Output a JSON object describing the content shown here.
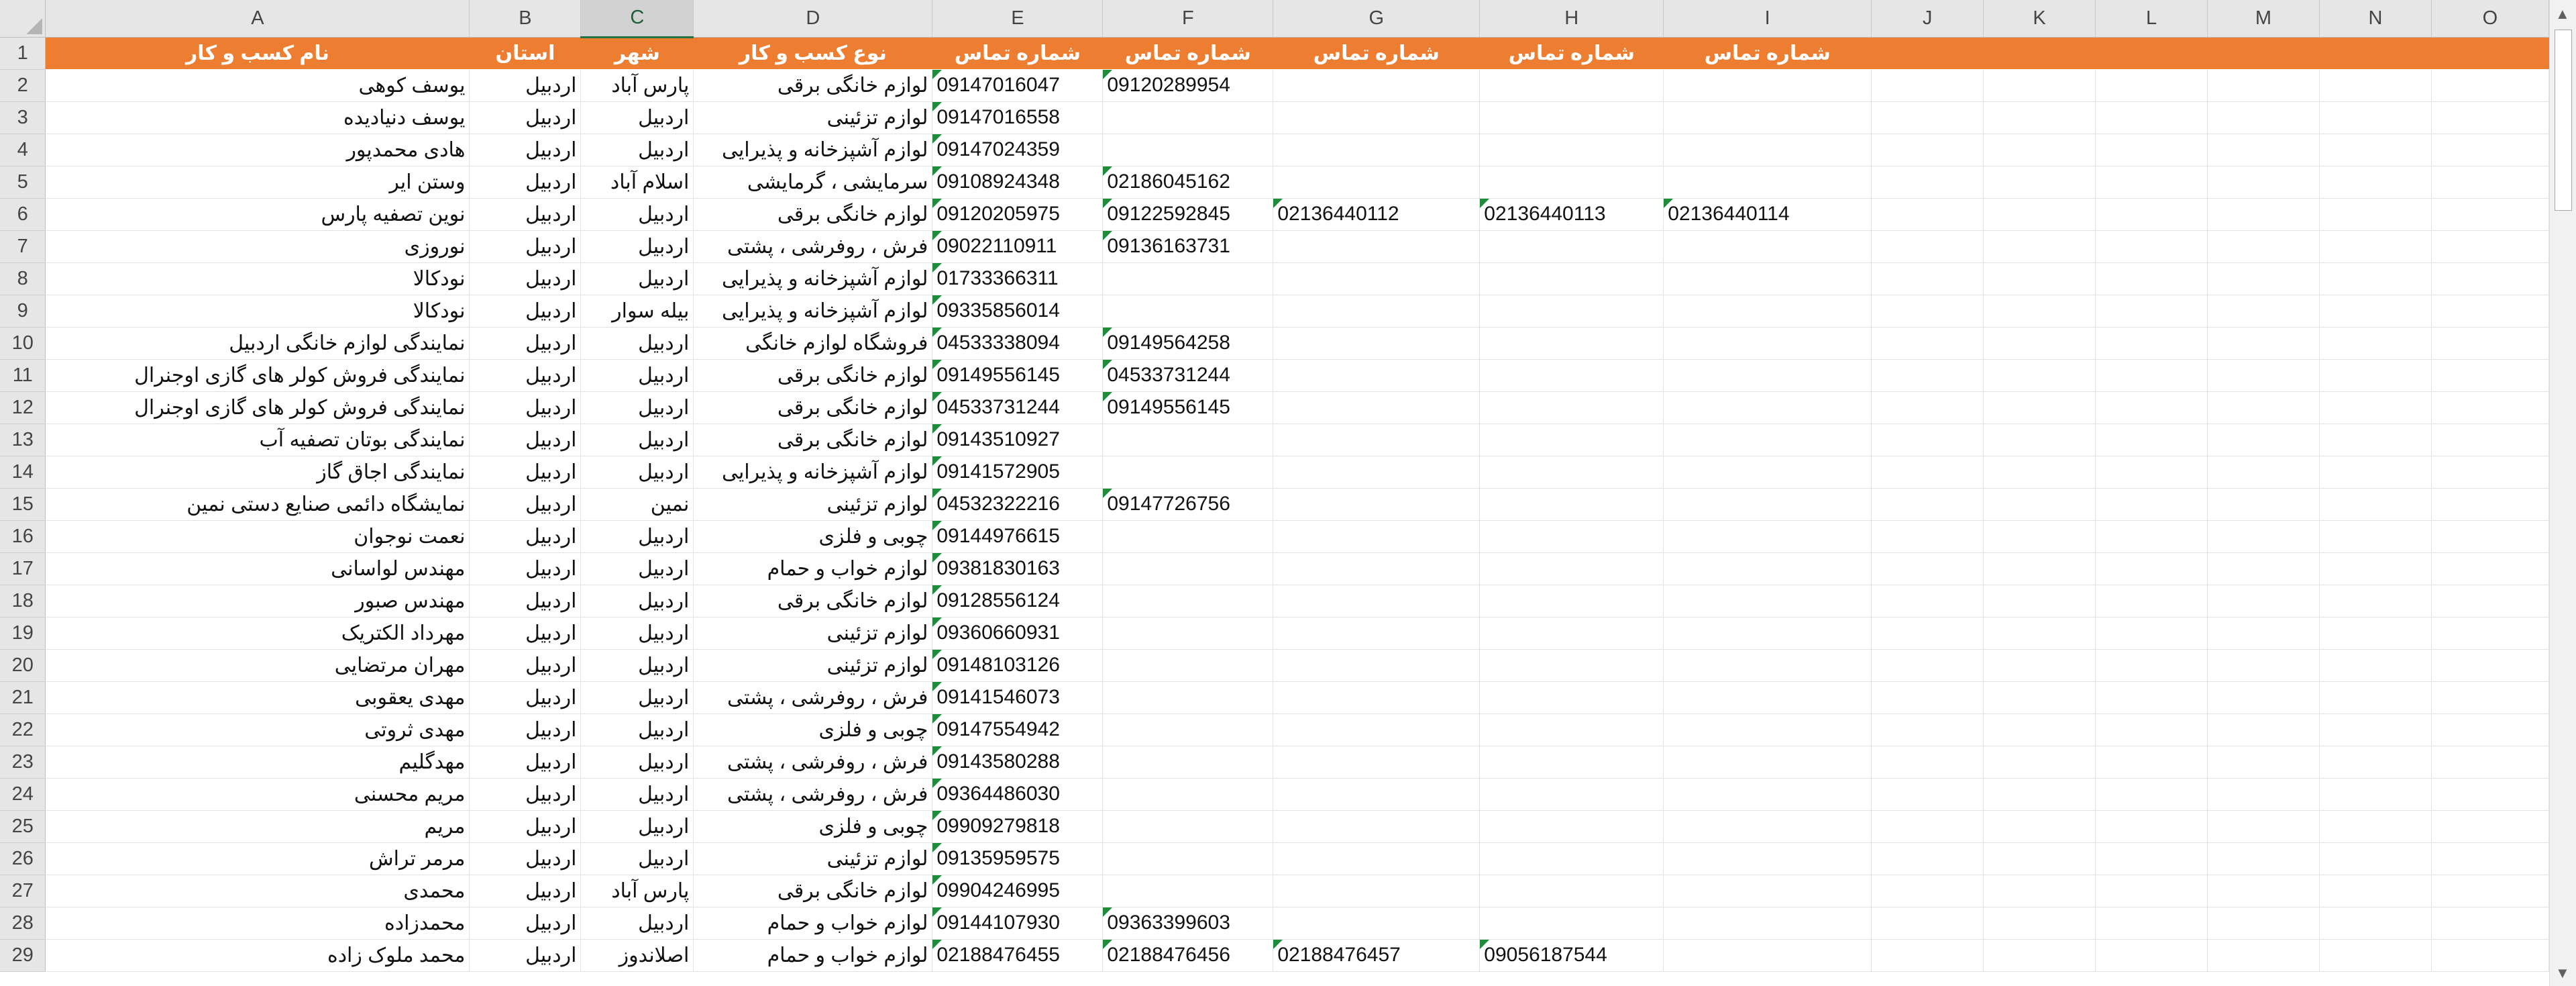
{
  "columns": [
    "A",
    "B",
    "C",
    "D",
    "E",
    "F",
    "G",
    "H",
    "I",
    "J",
    "K",
    "L",
    "M",
    "N",
    "O"
  ],
  "selected_column": "C",
  "colors": {
    "header_fill": "#ed7d31",
    "header_text": "#ffffff",
    "error_flag": "#1e8c3a",
    "selected_header": "#217346"
  },
  "rows": [
    {
      "n": "1",
      "header": true,
      "a": "نام کسب و کار",
      "b": "استان",
      "c": "شهر",
      "d": "نوع کسب و کار",
      "e": "شماره تماس",
      "f": "شماره تماس",
      "g": "شماره تماس",
      "h": "شماره تماس",
      "i": "شماره تماس"
    },
    {
      "n": "2",
      "a": "یوسف کوهی",
      "b": "اردبیل",
      "c": "پارس آباد",
      "d": "لوازم خانگی برقی",
      "e": "09147016047",
      "f": "09120289954",
      "g": "",
      "h": "",
      "i": ""
    },
    {
      "n": "3",
      "a": "یوسف دنیادیده",
      "b": "اردبیل",
      "c": "اردبیل",
      "d": "لوازم تزئینی",
      "e": "09147016558",
      "f": "",
      "g": "",
      "h": "",
      "i": ""
    },
    {
      "n": "4",
      "a": "هادی محمدپور",
      "b": "اردبیل",
      "c": "اردبیل",
      "d": "لوازم آشپزخانه و پذیرایی",
      "e": "09147024359",
      "f": "",
      "g": "",
      "h": "",
      "i": ""
    },
    {
      "n": "5",
      "a": "وستن ایر",
      "b": "اردبیل",
      "c": "اسلام آباد",
      "d": "سرمایشی ، گرمایشی",
      "e": "09108924348",
      "f": "02186045162",
      "g": "",
      "h": "",
      "i": ""
    },
    {
      "n": "6",
      "a": "نوین تصفیه پارس",
      "b": "اردبیل",
      "c": "اردبیل",
      "d": "لوازم خانگی برقی",
      "e": "09120205975",
      "f": "09122592845",
      "g": "02136440112",
      "h": "02136440113",
      "i": "02136440114"
    },
    {
      "n": "7",
      "a": "نوروزی",
      "b": "اردبیل",
      "c": "اردبیل",
      "d": "فرش ، روفرشی ، پشتی",
      "e": "09022110911",
      "f": "09136163731",
      "g": "",
      "h": "",
      "i": ""
    },
    {
      "n": "8",
      "a": "نودکالا",
      "b": "اردبیل",
      "c": "اردبیل",
      "d": "لوازم آشپزخانه و پذیرایی",
      "e": "01733366311",
      "f": "",
      "g": "",
      "h": "",
      "i": ""
    },
    {
      "n": "9",
      "a": "نودکالا",
      "b": "اردبیل",
      "c": "بیله سوار",
      "d": "لوازم آشپزخانه و پذیرایی",
      "e": "09335856014",
      "f": "",
      "g": "",
      "h": "",
      "i": ""
    },
    {
      "n": "10",
      "a": "نمایندگی لوازم خانگی اردبیل",
      "b": "اردبیل",
      "c": "اردبیل",
      "d": "فروشگاه لوازم خانگی",
      "e": "04533338094",
      "f": "09149564258",
      "g": "",
      "h": "",
      "i": ""
    },
    {
      "n": "11",
      "a": "نمایندگی فروش کولر های گازی اوجنرال",
      "b": "اردبیل",
      "c": "اردبیل",
      "d": "لوازم خانگی برقی",
      "e": "09149556145",
      "f": "04533731244",
      "g": "",
      "h": "",
      "i": ""
    },
    {
      "n": "12",
      "a": "نمایندگی فروش کولر های گازی اوجنرال",
      "b": "اردبیل",
      "c": "اردبیل",
      "d": "لوازم خانگی برقی",
      "e": "04533731244",
      "f": "09149556145",
      "g": "",
      "h": "",
      "i": ""
    },
    {
      "n": "13",
      "a": "نمایندگی بوتان  تصفیه آب",
      "b": "اردبیل",
      "c": "اردبیل",
      "d": "لوازم خانگی برقی",
      "e": "09143510927",
      "f": "",
      "g": "",
      "h": "",
      "i": ""
    },
    {
      "n": "14",
      "a": "نمایندگی اجاق گاز",
      "b": "اردبیل",
      "c": "اردبیل",
      "d": "لوازم آشپزخانه و پذیرایی",
      "e": "09141572905",
      "f": "",
      "g": "",
      "h": "",
      "i": ""
    },
    {
      "n": "15",
      "a": "نمایشگاه دائمی صنایع دستی نمین",
      "b": "اردبیل",
      "c": "نمین",
      "d": "لوازم تزئینی",
      "e": "04532322216",
      "f": "09147726756",
      "g": "",
      "h": "",
      "i": ""
    },
    {
      "n": "16",
      "a": "نعمت نوجوان",
      "b": "اردبیل",
      "c": "اردبیل",
      "d": "چوبی و فلزی",
      "e": "09144976615",
      "f": "",
      "g": "",
      "h": "",
      "i": ""
    },
    {
      "n": "17",
      "a": "مهندس لواسانی",
      "b": "اردبیل",
      "c": "اردبیل",
      "d": "لوازم خواب و حمام",
      "e": "09381830163",
      "f": "",
      "g": "",
      "h": "",
      "i": ""
    },
    {
      "n": "18",
      "a": "مهندس صبور",
      "b": "اردبیل",
      "c": "اردبیل",
      "d": "لوازم خانگی برقی",
      "e": "09128556124",
      "f": "",
      "g": "",
      "h": "",
      "i": ""
    },
    {
      "n": "19",
      "a": "مهرداد الکتریک",
      "b": "اردبیل",
      "c": "اردبیل",
      "d": "لوازم تزئینی",
      "e": "09360660931",
      "f": "",
      "g": "",
      "h": "",
      "i": ""
    },
    {
      "n": "20",
      "a": "مهران مرتضایی",
      "b": "اردبیل",
      "c": "اردبیل",
      "d": "لوازم تزئینی",
      "e": "09148103126",
      "f": "",
      "g": "",
      "h": "",
      "i": ""
    },
    {
      "n": "21",
      "a": "مهدی یعقوبی",
      "b": "اردبیل",
      "c": "اردبیل",
      "d": "فرش ، روفرشی ، پشتی",
      "e": "09141546073",
      "f": "",
      "g": "",
      "h": "",
      "i": ""
    },
    {
      "n": "22",
      "a": "مهدی ثروتی",
      "b": "اردبیل",
      "c": "اردبیل",
      "d": "چوبی و فلزی",
      "e": "09147554942",
      "f": "",
      "g": "",
      "h": "",
      "i": ""
    },
    {
      "n": "23",
      "a": "مهدگلیم",
      "b": "اردبیل",
      "c": "اردبیل",
      "d": "فرش ، روفرشی ، پشتی",
      "e": "09143580288",
      "f": "",
      "g": "",
      "h": "",
      "i": ""
    },
    {
      "n": "24",
      "a": "مریم محسنی",
      "b": "اردبیل",
      "c": "اردبیل",
      "d": "فرش ، روفرشی ، پشتی",
      "e": "09364486030",
      "f": "",
      "g": "",
      "h": "",
      "i": ""
    },
    {
      "n": "25",
      "a": "مریم",
      "b": "اردبیل",
      "c": "اردبیل",
      "d": "چوبی و فلزی",
      "e": "09909279818",
      "f": "",
      "g": "",
      "h": "",
      "i": ""
    },
    {
      "n": "26",
      "a": "مرمر تراش",
      "b": "اردبیل",
      "c": "اردبیل",
      "d": "لوازم تزئینی",
      "e": "09135959575",
      "f": "",
      "g": "",
      "h": "",
      "i": ""
    },
    {
      "n": "27",
      "a": "محمدی",
      "b": "اردبیل",
      "c": "پارس آباد",
      "d": "لوازم خانگی برقی",
      "e": "09904246995",
      "f": "",
      "g": "",
      "h": "",
      "i": ""
    },
    {
      "n": "28",
      "a": "محمدزاده",
      "b": "اردبیل",
      "c": "اردبیل",
      "d": "لوازم خواب و حمام",
      "e": "09144107930",
      "f": "09363399603",
      "g": "",
      "h": "",
      "i": ""
    },
    {
      "n": "29",
      "a": "محمد ملوک زاده",
      "b": "اردبیل",
      "c": "اصلاندوز",
      "d": "لوازم خواب و حمام",
      "e": "02188476455",
      "f": "02188476456",
      "g": "02188476457",
      "h": "09056187544",
      "i": ""
    }
  ],
  "scrollbar": {
    "up_icon": "▲",
    "down_icon": "▼"
  }
}
